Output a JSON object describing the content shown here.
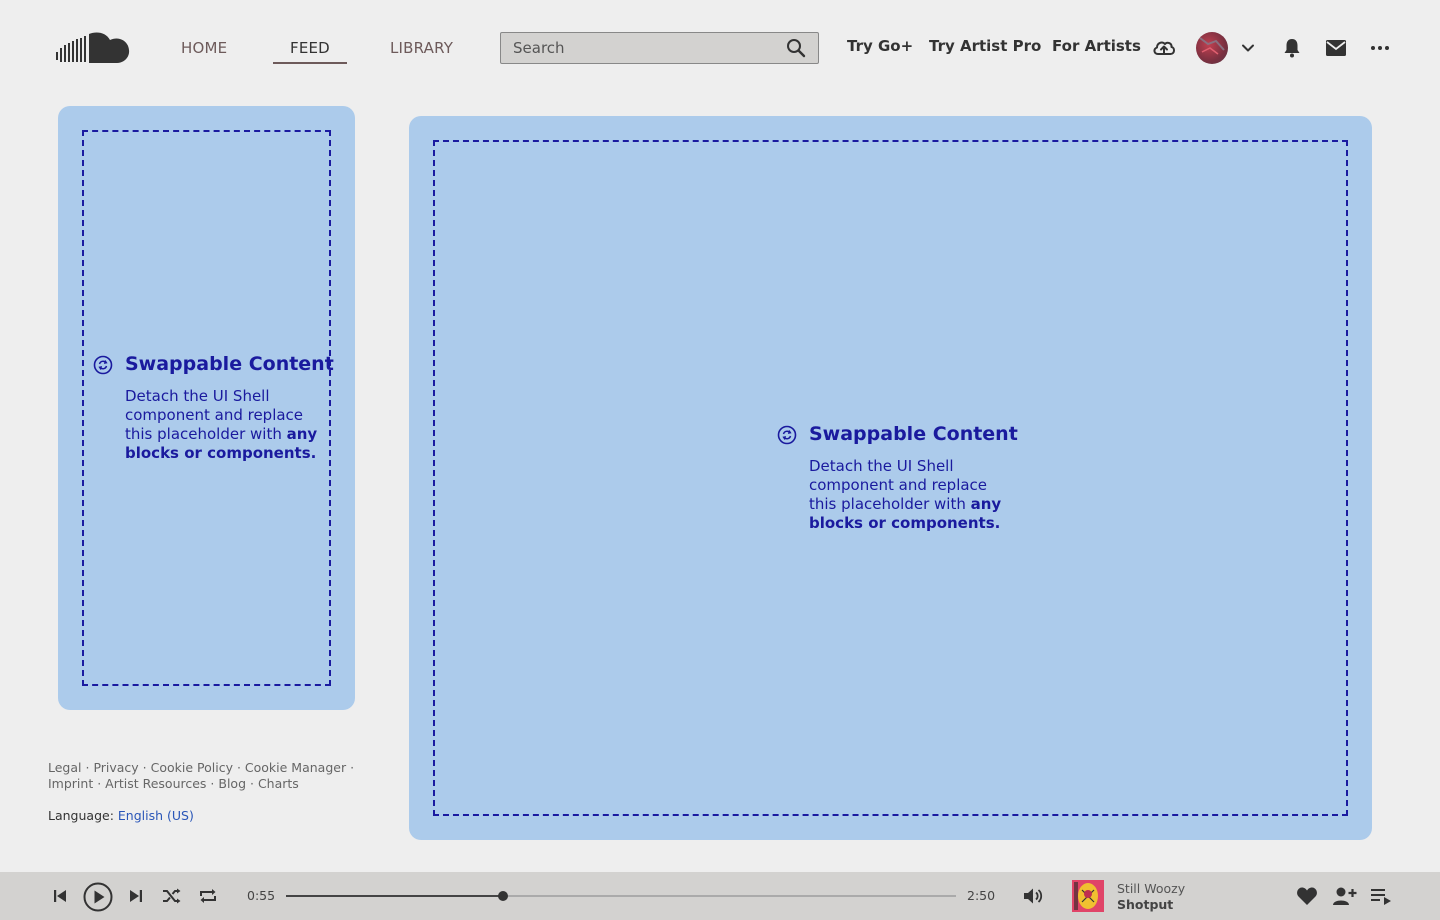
{
  "nav": {
    "items": [
      {
        "label": "HOME"
      },
      {
        "label": "FEED"
      },
      {
        "label": "LIBRARY"
      }
    ],
    "active": "FEED"
  },
  "search": {
    "placeholder": "Search"
  },
  "links": {
    "go_plus": "Try Go+",
    "artist_pro": "Try Artist Pro",
    "for_artists": "For Artists"
  },
  "placeholder": {
    "title": "Swappable Content",
    "body_plain": "Detach the UI Shell component and replace this placeholder with ",
    "body_bold": "any blocks or components."
  },
  "footer": {
    "links": [
      "Legal",
      "Privacy",
      "Cookie Policy",
      "Cookie Manager",
      "Imprint",
      "Artist Resources",
      "Blog",
      "Charts"
    ],
    "language_label": "Language:",
    "language_value": "English (US)"
  },
  "player": {
    "elapsed": "0:55",
    "duration": "2:50",
    "progress": 0.3235,
    "artist": "Still Woozy",
    "track": "Shotput"
  },
  "colors": {
    "panel": "#accbeb",
    "accent": "#1a1a9e",
    "brand": "#333333"
  }
}
